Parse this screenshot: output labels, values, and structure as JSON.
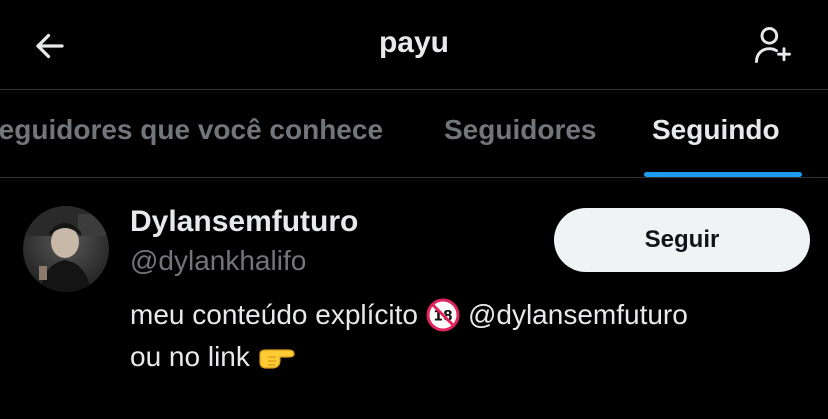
{
  "header": {
    "title": "payu",
    "back_icon": "arrow-left-icon",
    "add_user_icon": "person-add-icon"
  },
  "tabs": [
    {
      "label": "Seguidores que você conhece",
      "active": false
    },
    {
      "label": "Seguidores",
      "active": false
    },
    {
      "label": "Seguindo",
      "active": true
    }
  ],
  "users": [
    {
      "display_name": "Dylansemfuturo",
      "handle": "@dylankhalifo",
      "bio_part1": "meu conteúdo explícito",
      "bio_part2": "@dylansemfuturo",
      "bio_part3": "ou no link",
      "follow_label": "Seguir"
    }
  ],
  "colors": {
    "background": "#000000",
    "primary_text": "#e7e9ea",
    "secondary_text": "#71767b",
    "accent": "#1d9bf0",
    "button_bg": "#eff3f4"
  }
}
